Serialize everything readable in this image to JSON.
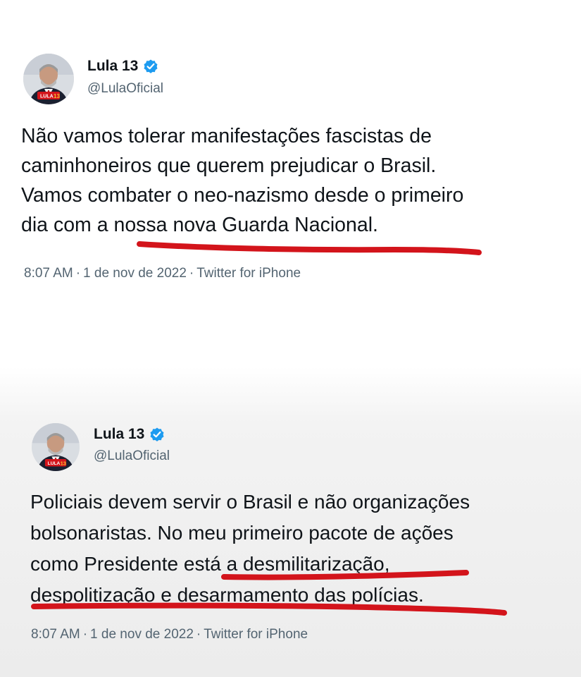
{
  "tweets": [
    {
      "display_name": "Lula 13",
      "handle": "@LulaOficial",
      "text_lines": [
        "Não vamos tolerar manifestações fascistas de",
        "caminhoneiros que querem prejudicar o Brasil.",
        "Vamos combater o neo-nazismo desde o primeiro",
        "dia com a nossa nova Guarda Nacional."
      ],
      "time": "8:07 AM",
      "date": "1 de nov de 2022",
      "source": "Twitter for iPhone",
      "avatar_badge_text": "LULA 13"
    },
    {
      "display_name": "Lula 13",
      "handle": "@LulaOficial",
      "text_lines": [
        "Policiais devem servir o Brasil e não organizações",
        "bolsonaristas. No meu primeiro pacote de ações",
        "como Presidente está a desmilitarização,",
        "despolitização e desarmamento das polícias."
      ],
      "time": "8:07 AM",
      "date": "1 de nov de 2022",
      "source": "Twitter for iPhone",
      "avatar_badge_text": "LULA 13"
    }
  ],
  "separator": "·",
  "icons": {
    "verified": "verified-badge-icon",
    "avatar": "profile-photo"
  },
  "colors": {
    "verified_blue": "#1d9bf0",
    "underline_red": "#d3141b",
    "text": "#0f1419",
    "secondary_text": "#536471"
  }
}
